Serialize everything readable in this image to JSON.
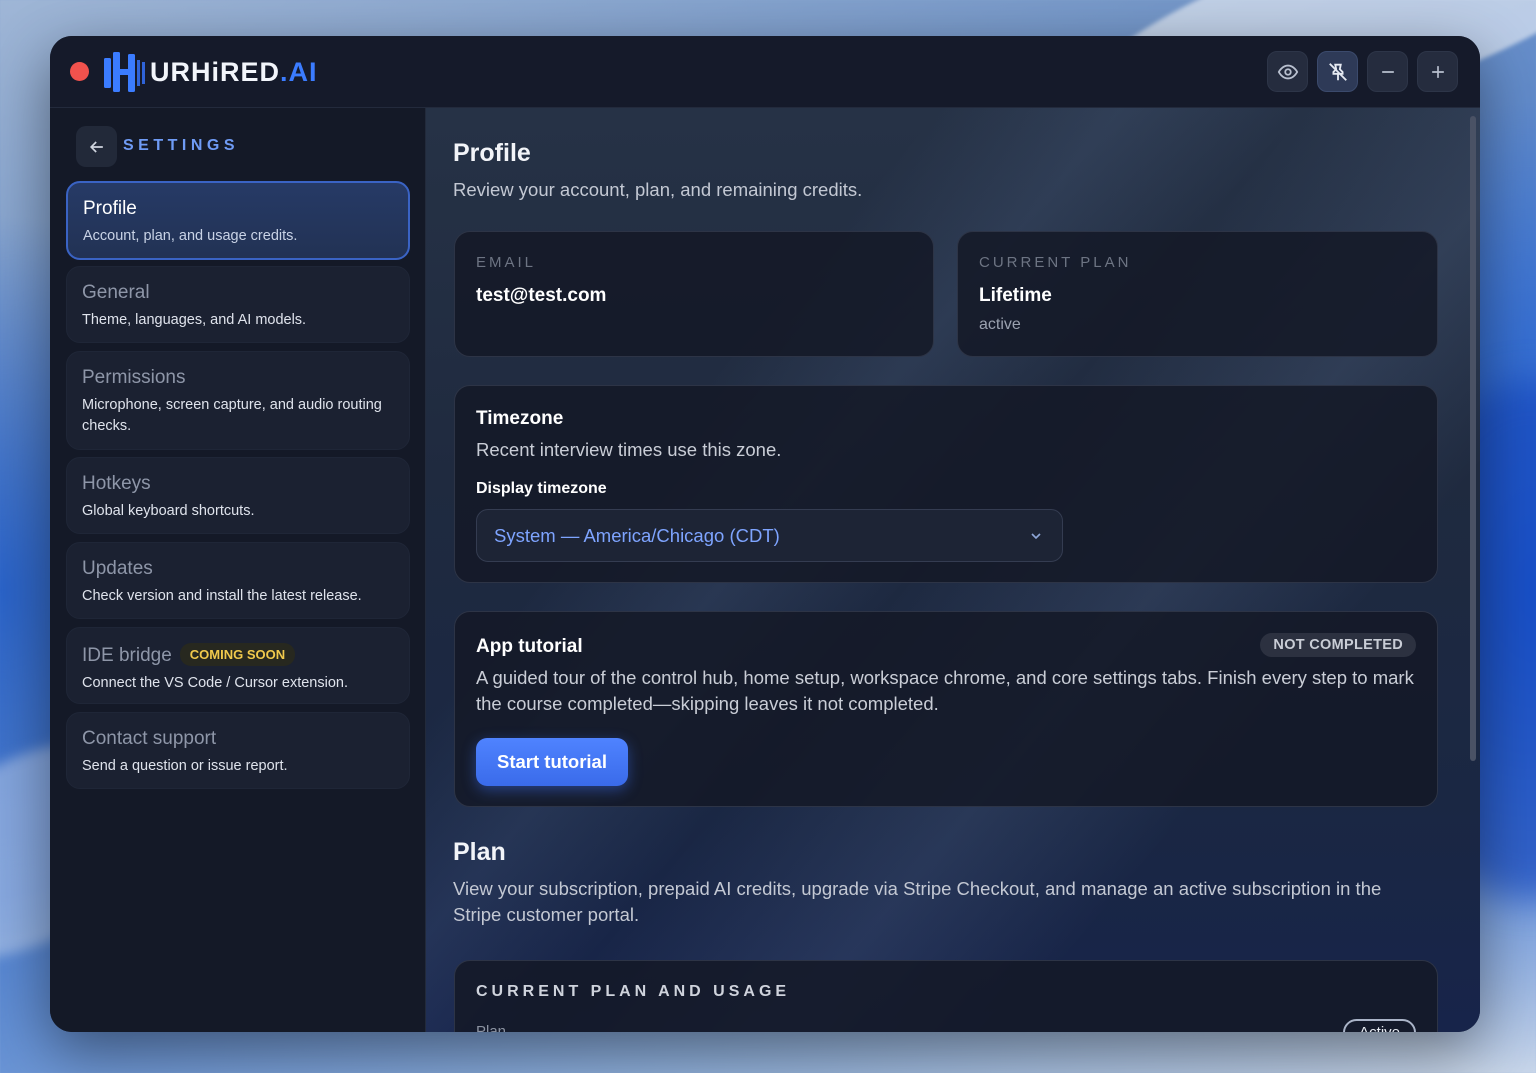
{
  "app": {
    "logo_prefix": "URHiRED",
    "logo_suffix": ".AI"
  },
  "window_controls": [
    {
      "name": "visibility",
      "icon": "eye-icon"
    },
    {
      "name": "unpin",
      "icon": "pin-off-icon"
    },
    {
      "name": "minimize",
      "icon": "minus-icon"
    },
    {
      "name": "expand",
      "icon": "plus-icon"
    }
  ],
  "sidebar": {
    "title": "SETTINGS",
    "items": [
      {
        "title": "Profile",
        "desc": "Account, plan, and usage credits."
      },
      {
        "title": "General",
        "desc": "Theme, languages, and AI models."
      },
      {
        "title": "Permissions",
        "desc": "Microphone, screen capture, and audio routing checks."
      },
      {
        "title": "Hotkeys",
        "desc": "Global keyboard shortcuts."
      },
      {
        "title": "Updates",
        "desc": "Check version and install the latest release."
      },
      {
        "title": "IDE bridge",
        "badge": "COMING SOON",
        "desc": "Connect the VS Code / Cursor extension."
      },
      {
        "title": "Contact support",
        "desc": "Send a question or issue report."
      }
    ]
  },
  "profile": {
    "heading": "Profile",
    "subtitle": "Review your account, plan, and remaining credits.",
    "email_label": "EMAIL",
    "email_value": "test@test.com",
    "plan_label": "CURRENT PLAN",
    "plan_value": "Lifetime",
    "plan_status": "active"
  },
  "timezone": {
    "title": "Timezone",
    "desc": "Recent interview times use this zone.",
    "field_label": "Display timezone",
    "selected": "System — America/Chicago (CDT)"
  },
  "tutorial": {
    "title": "App tutorial",
    "badge": "NOT COMPLETED",
    "desc": "A guided tour of the control hub, home setup, workspace chrome, and core settings tabs. Finish every step to mark the course completed—skipping leaves it not completed.",
    "button": "Start tutorial"
  },
  "plan_section": {
    "heading": "Plan",
    "subtitle": "View your subscription, prepaid AI credits, upgrade via Stripe Checkout, and manage an active subscription in the Stripe customer portal.",
    "usage_title": "CURRENT PLAN AND USAGE",
    "plan_field": "Plan",
    "status_badge": "Active"
  },
  "colors": {
    "accent": "#3b7cff",
    "close_dot": "#f0524d",
    "badge_soon": "#f0c94c"
  }
}
